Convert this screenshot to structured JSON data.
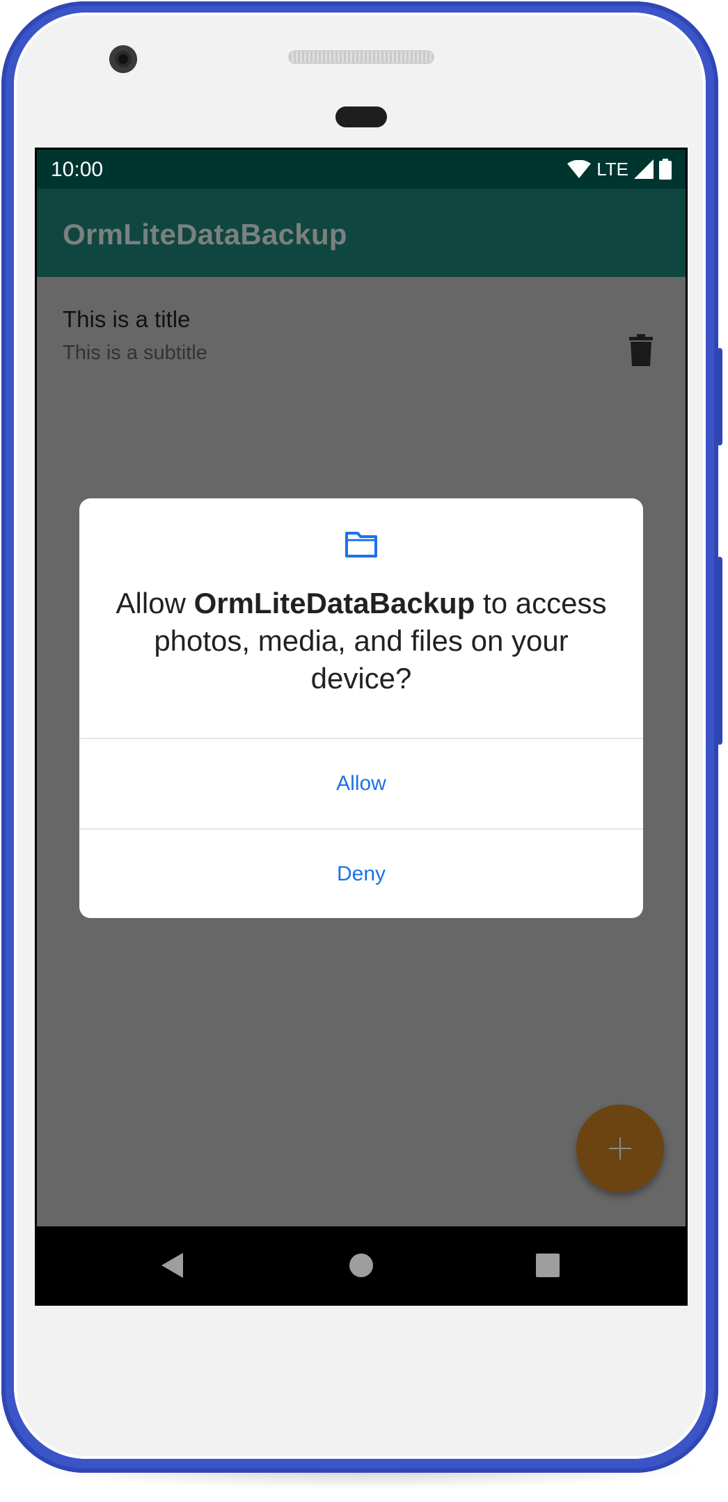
{
  "status_bar": {
    "time": "10:00",
    "network": "LTE",
    "icons": [
      "wifi-icon",
      "signal-icon",
      "battery-icon"
    ]
  },
  "app_bar": {
    "title": "OrmLiteDataBackup"
  },
  "list": {
    "items": [
      {
        "title": "This is a title",
        "subtitle": "This is a subtitle",
        "action_icon": "trash-icon"
      }
    ]
  },
  "fab": {
    "icon": "plus-icon",
    "color": "#6b4412"
  },
  "dialog": {
    "icon": "folder-icon",
    "message_prefix": "Allow ",
    "app_name": "OrmLiteDataBackup",
    "message_suffix": " to access photos, media, and files on your device?",
    "allow_label": "Allow",
    "deny_label": "Deny",
    "accent_color": "#1a73e8"
  },
  "nav_bar": {
    "buttons": [
      "back-icon",
      "home-icon",
      "recents-icon"
    ]
  },
  "colors": {
    "status_bar": "#00352f",
    "app_bar": "#104640",
    "scrim_content": "#676767",
    "device_frame": "#3b55c8"
  }
}
